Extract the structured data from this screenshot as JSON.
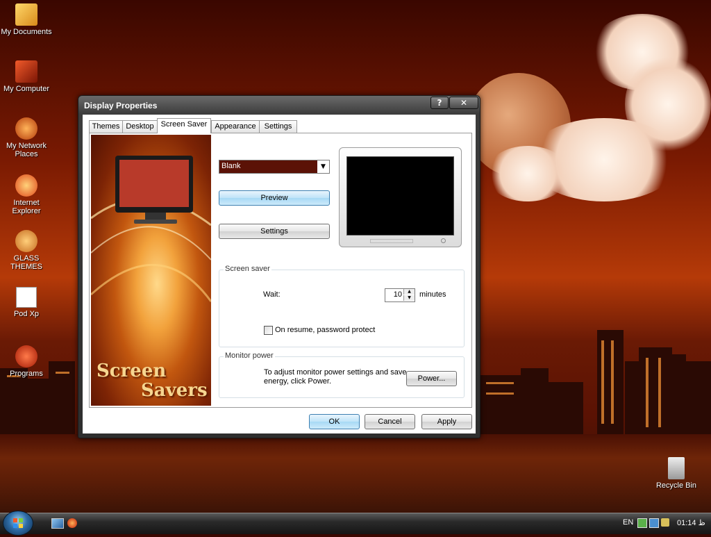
{
  "desktop": {
    "icons": [
      {
        "label": "My Documents"
      },
      {
        "label": "My Computer"
      },
      {
        "label": "My Network Places"
      },
      {
        "label": "Internet Explorer"
      },
      {
        "label": "GLASS THEMES"
      },
      {
        "label": "Pod Xp"
      },
      {
        "label": "Programs"
      },
      {
        "label": "Recycle Bin"
      }
    ]
  },
  "window": {
    "title": "Display Properties",
    "help_label": "?",
    "close_label": "✕",
    "tabs": [
      {
        "label": "Themes"
      },
      {
        "label": "Desktop"
      },
      {
        "label": "Screen Saver"
      },
      {
        "label": "Appearance"
      },
      {
        "label": "Settings"
      }
    ],
    "active_tab": "Screen Saver",
    "art": {
      "line1": "Screen",
      "line2": "Savers"
    },
    "screensaver_select": {
      "value": "Blank"
    },
    "preview_label": "Preview",
    "settings_label": "Settings",
    "screen_saver_group": {
      "title": "Screen saver",
      "wait_label": "Wait:",
      "wait_value": "10",
      "minutes_label": "minutes",
      "password_label": "On resume, password protect",
      "password_checked": false
    },
    "monitor_power_group": {
      "title": "Monitor power",
      "text": "To adjust monitor power settings and save energy, click Power.",
      "power_label": "Power..."
    },
    "footer": {
      "ok": "OK",
      "cancel": "Cancel",
      "apply": "Apply"
    }
  },
  "taskbar": {
    "language": "EN",
    "clock": "01:14 ظ"
  },
  "colors": {
    "accent_button": "#bfe3f8",
    "combo_bg": "#5b1206"
  }
}
